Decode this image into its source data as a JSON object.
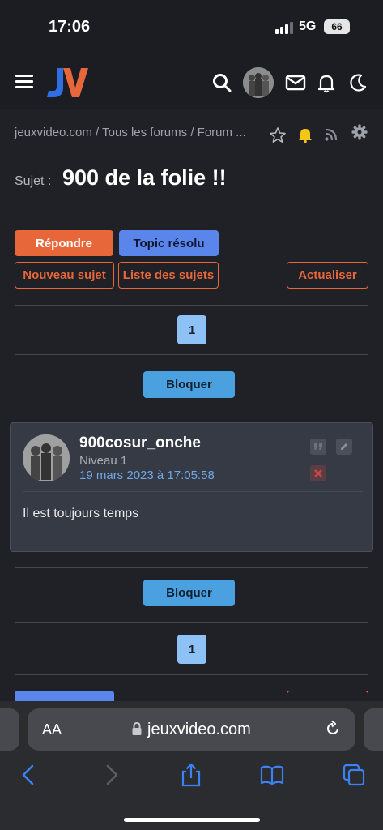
{
  "status_bar": {
    "time": "17:06",
    "network": "5G",
    "battery": "66"
  },
  "header": {
    "logo_alt": "JV"
  },
  "breadcrumb": {
    "text": "jeuxvideo.com / Tous les forums / Forum ..."
  },
  "topic": {
    "subject_label": "Sujet :",
    "title": "900 de la folie !!"
  },
  "actions": {
    "reply": "Répondre",
    "resolved": "Topic résolu",
    "new_topic": "Nouveau sujet",
    "topic_list": "Liste des sujets",
    "refresh": "Actualiser"
  },
  "pagination": {
    "current_page": "1"
  },
  "block_button": "Bloquer",
  "post": {
    "author": "900cosur_onche",
    "level": "Niveau 1",
    "date": "19 mars 2023 à 17:05:58",
    "message": "Il est toujours temps"
  },
  "browser": {
    "text_size_label": "AA",
    "url": "jeuxvideo.com"
  },
  "colors": {
    "accent_orange": "#e8673a",
    "accent_blue": "#5a86ec",
    "link_blue": "#6fa8e6",
    "bell_yellow": "#f5c518"
  }
}
